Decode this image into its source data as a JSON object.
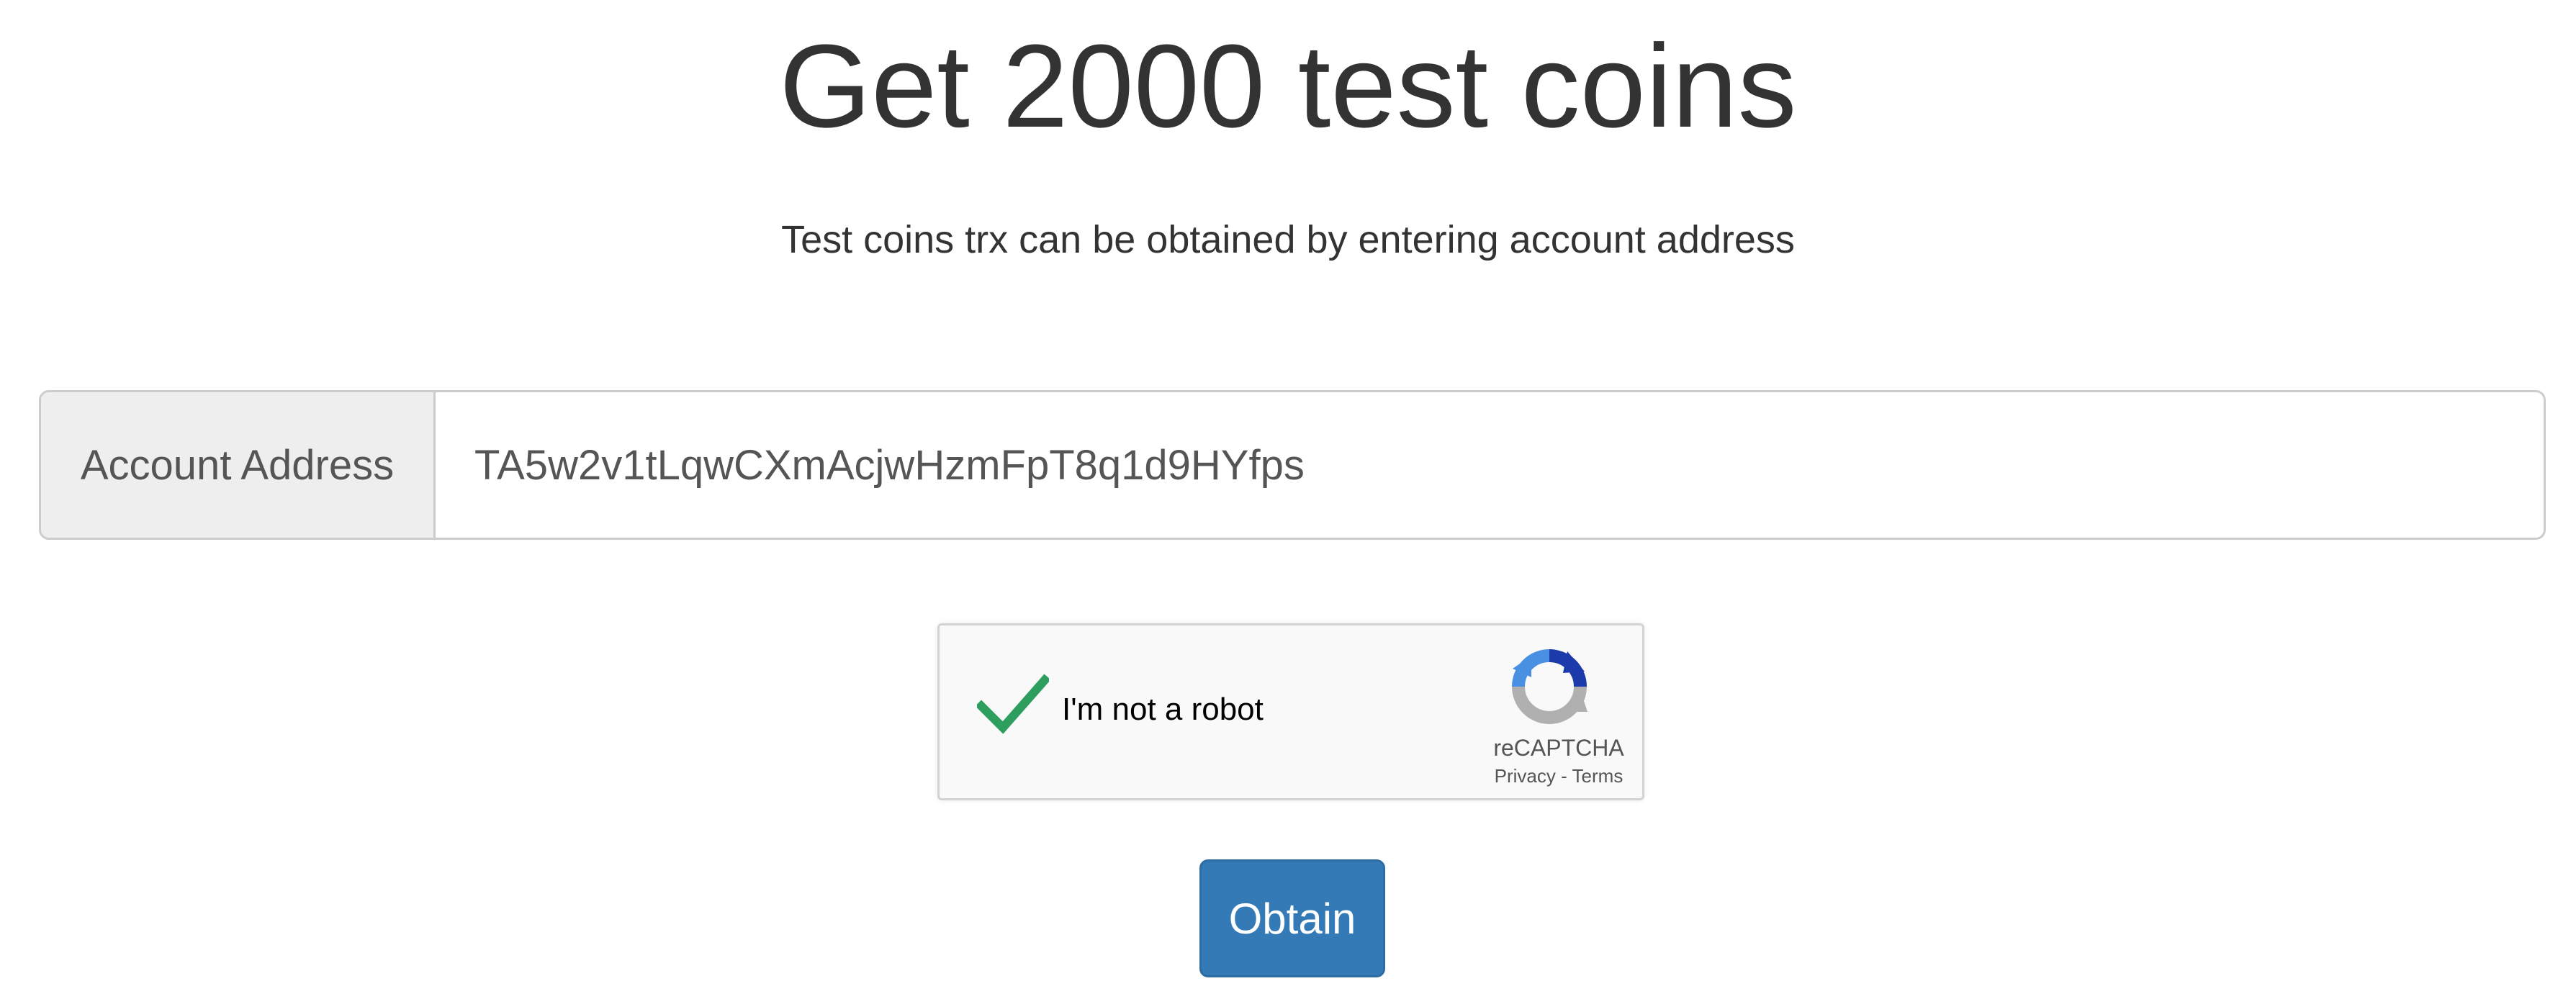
{
  "page": {
    "title": "Get 2000 test coins",
    "subtitle": "Test coins trx can be obtained by entering account address"
  },
  "form": {
    "address_label": "Account Address",
    "address_value": "TA5w2v1tLqwCXmAcjwHzmFpT8q1d9HYfps"
  },
  "recaptcha": {
    "checked": true,
    "label": "I'm not a robot",
    "brand": "reCAPTCHA",
    "privacy": "Privacy",
    "separator": " - ",
    "terms": "Terms",
    "check_color": "#2e9e5e"
  },
  "actions": {
    "obtain_label": "Obtain",
    "button_color": "#337ab7"
  }
}
